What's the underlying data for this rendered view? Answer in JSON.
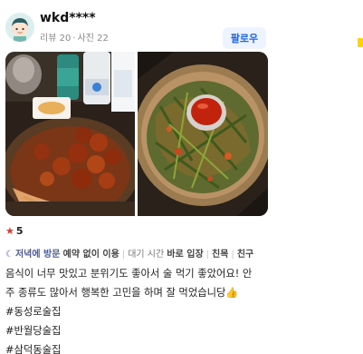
{
  "header": {
    "username": "wkd****",
    "reviews": "리뷰 20",
    "photos": "사진 22",
    "follow_label": "팔로우"
  },
  "icons": {
    "avatar": "user-avatar-icon",
    "star": "star-icon",
    "moon": "moon-icon",
    "thumbs": "thumbs-up-emoji"
  },
  "colors": {
    "accent": "#1e64e6",
    "follow_bg": "#edf3ff",
    "star": "#e5362c",
    "side_marker": "#ffd500"
  },
  "rating": "5",
  "tags": {
    "visit_time": "저녁에 방문",
    "reservation": "예약 없이 이용",
    "wait_label": "대기 시간",
    "wait_value": "바로 입장",
    "purpose": "친목",
    "companion": "친구"
  },
  "review": {
    "line1": "음식이 너무 맛있고 분위기도 좋아서 술 먹기 좋았어요! 안",
    "line2": "주 종류도 많아서 행복한 고민을 하며 잘 먹었습니당",
    "emoji": "👍",
    "hashtags": [
      "#동성로술집",
      "#반월당술집",
      "#삼덕동술집"
    ]
  }
}
